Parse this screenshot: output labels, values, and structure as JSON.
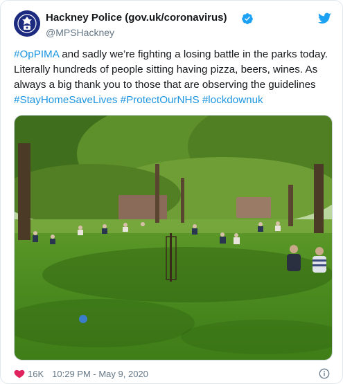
{
  "account": {
    "name": "Hackney Police (gov.uk/coronavirus)",
    "handle": "@MPSHackney",
    "verified": true,
    "avatar_icon": "met-police-crest-icon"
  },
  "tweet": {
    "segments": [
      {
        "text": "#OpPIMA",
        "type": "hashtag"
      },
      {
        "text": " and sadly we’re fighting a losing battle in the parks today. Literally hundreds of people sitting having pizza, beers, wines. As always a big thank you to those that are observing the guidelines ",
        "type": "text"
      },
      {
        "text": "#StayHomeSaveLives",
        "type": "hashtag"
      },
      {
        "text": " ",
        "type": "text"
      },
      {
        "text": "#ProtectOurNHS",
        "type": "hashtag"
      },
      {
        "text": " ",
        "type": "text"
      },
      {
        "text": "#lockdownuk",
        "type": "hashtag"
      }
    ]
  },
  "footer": {
    "likes": "16K",
    "timestamp": "10:29 PM - May 9, 2020"
  },
  "icons": {
    "brand": "twitter-bird-icon",
    "like": "heart-icon",
    "info": "info-icon"
  },
  "colors": {
    "link": "#1b95e0",
    "verified": "#1da1f2",
    "muted": "#657786",
    "like": "#e0245e"
  }
}
